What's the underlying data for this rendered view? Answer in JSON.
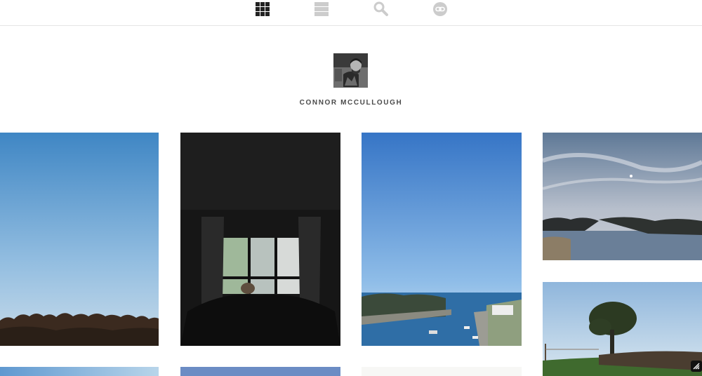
{
  "profile": {
    "username": "CONNOR MCCULLOUGH"
  },
  "nav": {
    "items": [
      {
        "icon": "grid-icon",
        "active": true
      },
      {
        "icon": "list-icon",
        "active": false
      },
      {
        "icon": "search-icon",
        "active": false
      },
      {
        "icon": "link-icon",
        "active": false
      }
    ]
  },
  "colors": {
    "active_icon": "#222222",
    "inactive_icon": "#cccccc",
    "username_text": "#4a4a4a",
    "divider": "#e4e4e4"
  }
}
